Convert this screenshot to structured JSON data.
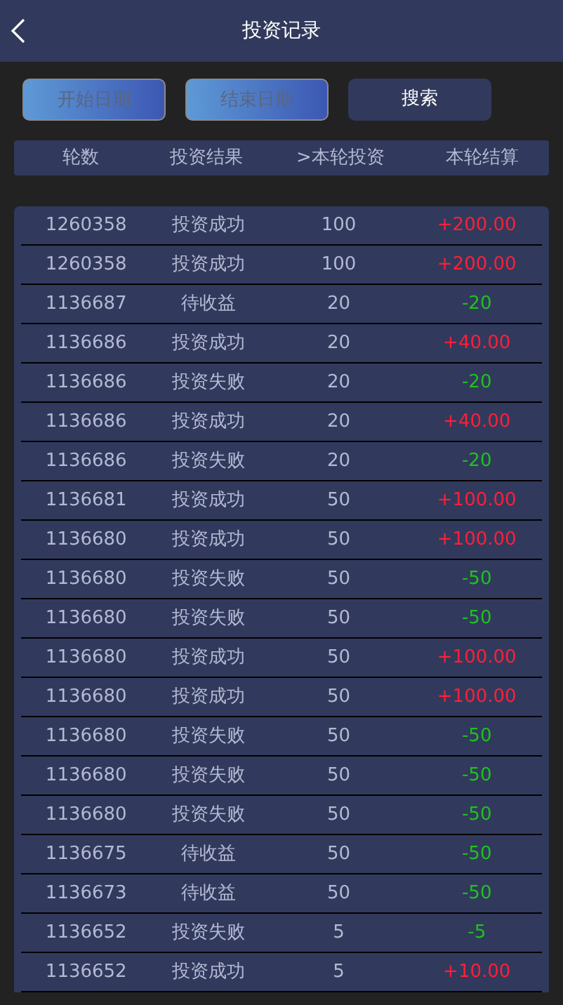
{
  "header": {
    "title": "投资记录"
  },
  "filters": {
    "start_date": {
      "placeholder": "开始日期"
    },
    "end_date": {
      "placeholder": "结束日期"
    },
    "search_button": "搜索"
  },
  "table": {
    "columns": [
      "轮数",
      "投资结果",
      ">本轮投资",
      "本轮结算"
    ],
    "rows": [
      {
        "round": "1260358",
        "result": "投资成功",
        "stake": "100",
        "settlement": "+200.00",
        "kind": "gain"
      },
      {
        "round": "1260358",
        "result": "投资成功",
        "stake": "100",
        "settlement": "+200.00",
        "kind": "gain"
      },
      {
        "round": "1136687",
        "result": "待收益",
        "stake": "20",
        "settlement": "-20",
        "kind": "loss"
      },
      {
        "round": "1136686",
        "result": "投资成功",
        "stake": "20",
        "settlement": "+40.00",
        "kind": "gain"
      },
      {
        "round": "1136686",
        "result": "投资失败",
        "stake": "20",
        "settlement": "-20",
        "kind": "loss"
      },
      {
        "round": "1136686",
        "result": "投资成功",
        "stake": "20",
        "settlement": "+40.00",
        "kind": "gain"
      },
      {
        "round": "1136686",
        "result": "投资失败",
        "stake": "20",
        "settlement": "-20",
        "kind": "loss"
      },
      {
        "round": "1136681",
        "result": "投资成功",
        "stake": "50",
        "settlement": "+100.00",
        "kind": "gain"
      },
      {
        "round": "1136680",
        "result": "投资成功",
        "stake": "50",
        "settlement": "+100.00",
        "kind": "gain"
      },
      {
        "round": "1136680",
        "result": "投资失败",
        "stake": "50",
        "settlement": "-50",
        "kind": "loss"
      },
      {
        "round": "1136680",
        "result": "投资失败",
        "stake": "50",
        "settlement": "-50",
        "kind": "loss"
      },
      {
        "round": "1136680",
        "result": "投资成功",
        "stake": "50",
        "settlement": "+100.00",
        "kind": "gain"
      },
      {
        "round": "1136680",
        "result": "投资成功",
        "stake": "50",
        "settlement": "+100.00",
        "kind": "gain"
      },
      {
        "round": "1136680",
        "result": "投资失败",
        "stake": "50",
        "settlement": "-50",
        "kind": "loss"
      },
      {
        "round": "1136680",
        "result": "投资失败",
        "stake": "50",
        "settlement": "-50",
        "kind": "loss"
      },
      {
        "round": "1136680",
        "result": "投资失败",
        "stake": "50",
        "settlement": "-50",
        "kind": "loss"
      },
      {
        "round": "1136675",
        "result": "待收益",
        "stake": "50",
        "settlement": "-50",
        "kind": "loss"
      },
      {
        "round": "1136673",
        "result": "待收益",
        "stake": "50",
        "settlement": "-50",
        "kind": "loss"
      },
      {
        "round": "1136652",
        "result": "投资失败",
        "stake": "5",
        "settlement": "-5",
        "kind": "loss"
      },
      {
        "round": "1136652",
        "result": "投资成功",
        "stake": "5",
        "settlement": "+10.00",
        "kind": "gain"
      }
    ]
  }
}
